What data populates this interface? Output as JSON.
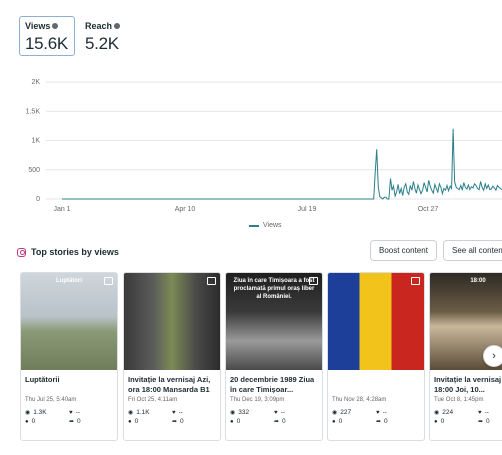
{
  "metrics": [
    {
      "label": "Views",
      "value": "15.6K",
      "active": true
    },
    {
      "label": "Reach",
      "value": "5.2K",
      "active": false
    }
  ],
  "chart_data": {
    "type": "line",
    "y_ticks": [
      "2K",
      "1.5K",
      "1K",
      "500",
      "0"
    ],
    "ylim": [
      0,
      2000
    ],
    "x_ticks": [
      "Jan 1",
      "Apr 10",
      "Jul 19",
      "Oct 27"
    ],
    "series": [
      {
        "name": "Views",
        "color": "#2a7f8b",
        "values": [
          0,
          0,
          0,
          0,
          0,
          0,
          0,
          0,
          0,
          0,
          0,
          0,
          0,
          0,
          0,
          0,
          0,
          0,
          0,
          0,
          0,
          0,
          0,
          0,
          0,
          0,
          0,
          0,
          0,
          0,
          0,
          0,
          0,
          0,
          0,
          0,
          0,
          0,
          0,
          0,
          0,
          0,
          0,
          0,
          0,
          0,
          0,
          0,
          0,
          0,
          0,
          0,
          0,
          0,
          0,
          0,
          0,
          0,
          0,
          0,
          0,
          0,
          0,
          0,
          0,
          0,
          0,
          0,
          0,
          0,
          0,
          0,
          0,
          0,
          0,
          0,
          0,
          0,
          0,
          0,
          0,
          0,
          0,
          0,
          0,
          0,
          0,
          0,
          0,
          0,
          0,
          0,
          0,
          0,
          0,
          0,
          0,
          0,
          0,
          0,
          0,
          0,
          0,
          0,
          0,
          0,
          0,
          0,
          0,
          0,
          0,
          0,
          0,
          0,
          0,
          0,
          0,
          0,
          0,
          0,
          0,
          0,
          0,
          0,
          0,
          0,
          0,
          0,
          0,
          0,
          0,
          0,
          0,
          0,
          0,
          0,
          0,
          0,
          0,
          0,
          0,
          0,
          0,
          0,
          0,
          0,
          0,
          0,
          0,
          0,
          0,
          0,
          0,
          0,
          0,
          0,
          0,
          0,
          0,
          0,
          0,
          0,
          0,
          0,
          0,
          0,
          0,
          0,
          0,
          0,
          0,
          0,
          0,
          0,
          0,
          0,
          0,
          0,
          0,
          0,
          0,
          0,
          0,
          0,
          0,
          0,
          0,
          0,
          0,
          0,
          0,
          0,
          0,
          0,
          0,
          0,
          0,
          0,
          0,
          0,
          0,
          0,
          0,
          0,
          0,
          450,
          850,
          200,
          40,
          20,
          0,
          30,
          30,
          0,
          0,
          350,
          150,
          220,
          50,
          120,
          250,
          90,
          180,
          60,
          200,
          260,
          120,
          80,
          230,
          150,
          300,
          180,
          100,
          240,
          160,
          90,
          150,
          280,
          200,
          120,
          320,
          220,
          150,
          100,
          250,
          180,
          120,
          260,
          200,
          90,
          180,
          150,
          230,
          140,
          220,
          180,
          1200,
          300,
          200,
          180,
          160,
          230,
          150,
          280,
          200,
          170,
          240,
          160,
          210,
          190,
          260,
          230,
          180,
          160,
          300,
          200,
          150,
          260,
          180,
          240,
          160,
          170,
          220,
          190,
          150,
          230,
          200,
          180,
          160
        ]
      }
    ],
    "legend": "bottom"
  },
  "legend_label": "Views",
  "stories": {
    "title": "Top stories by views",
    "boost_label": "Boost content",
    "see_all_label": "See all content",
    "items": [
      {
        "title": "Luptătorii",
        "date": "Thu Jul 25, 5:40am",
        "views": "1.3K",
        "likes": "--",
        "replies": "0",
        "shares": "0",
        "thumb": "photo-field",
        "overlay": "Luptători"
      },
      {
        "title": "Invitație la vernisaj Azi, ora 18:00 Mansarda B1",
        "date": "Fri Oct 25, 4:11am",
        "views": "1.1K",
        "likes": "--",
        "replies": "0",
        "shares": "0",
        "thumb": "photo-costume",
        "overlay": ""
      },
      {
        "title": "20 decembrie 1989 Ziua în care Timișoar...",
        "date": "Thu Dec 19, 3:09pm",
        "views": "332",
        "likes": "--",
        "replies": "0",
        "shares": "0",
        "thumb": "photo-bw",
        "overlay": "Ziua în care Timișoara a fost proclamată primul oraș liber al României."
      },
      {
        "title": "",
        "date": "Thu Nov 28, 4:28am",
        "views": "227",
        "likes": "--",
        "replies": "0",
        "shares": "0",
        "thumb": "photo-flag",
        "overlay": ""
      },
      {
        "title": "Invitație la vernisaj 18:00 Joi, 10...",
        "date": "Tue Oct 8, 1:45pm",
        "views": "224",
        "likes": "--",
        "replies": "0",
        "shares": "0",
        "thumb": "photo-poster",
        "overlay": "18:00"
      }
    ]
  }
}
